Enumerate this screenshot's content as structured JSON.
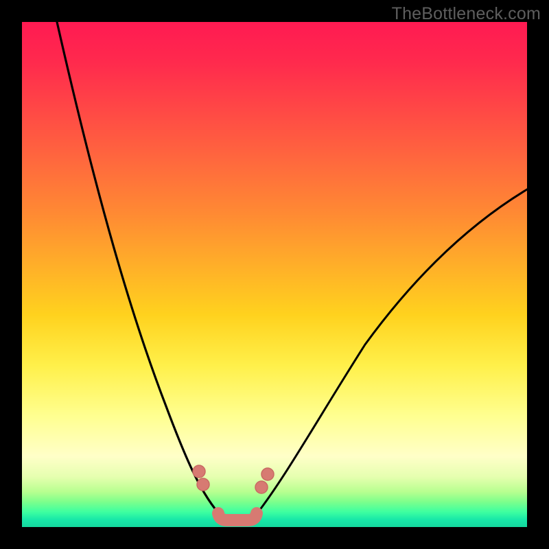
{
  "watermark": {
    "text": "TheBottleneck.com"
  },
  "colors": {
    "frame": "#000000",
    "curve": "#000000",
    "marker_fill": "#d77a72",
    "marker_stroke": "#c86a63"
  },
  "chart_data": {
    "type": "line",
    "title": "",
    "xlabel": "",
    "ylabel": "",
    "xlim": [
      0,
      100
    ],
    "ylim": [
      0,
      100
    ],
    "grid": false,
    "legend": false,
    "note": "Axes are unitless; values estimated from pixel geometry. y=0 is the bottom (green) edge.",
    "series": [
      {
        "name": "left-curve",
        "x": [
          7,
          10,
          13,
          16,
          19,
          22,
          25,
          28,
          30,
          32,
          34,
          35.5,
          37,
          38.5,
          40
        ],
        "y": [
          100,
          89,
          78,
          67,
          57,
          47,
          38,
          30,
          24,
          18,
          13,
          9,
          6,
          3.5,
          2
        ]
      },
      {
        "name": "right-curve",
        "x": [
          45,
          47,
          49,
          52,
          56,
          60,
          65,
          70,
          76,
          82,
          88,
          94,
          100
        ],
        "y": [
          2,
          3.5,
          6,
          10,
          16,
          22,
          29,
          36,
          43,
          50,
          56,
          62,
          67
        ]
      },
      {
        "name": "bottom-band",
        "x": [
          40,
          41.5,
          43,
          44.5,
          46
        ],
        "y": [
          1.6,
          1.2,
          1.0,
          1.2,
          1.6
        ]
      }
    ],
    "markers": {
      "left": [
        {
          "x": 35.0,
          "y": 11.0
        },
        {
          "x": 35.8,
          "y": 8.5
        }
      ],
      "right": [
        {
          "x": 47.3,
          "y": 8.0
        },
        {
          "x": 48.6,
          "y": 10.5
        }
      ],
      "bottom_band": {
        "start": {
          "x": 38.8,
          "y": 2.0
        },
        "end": {
          "x": 46.0,
          "y": 2.0
        },
        "radius_pct": 1.25
      }
    }
  }
}
